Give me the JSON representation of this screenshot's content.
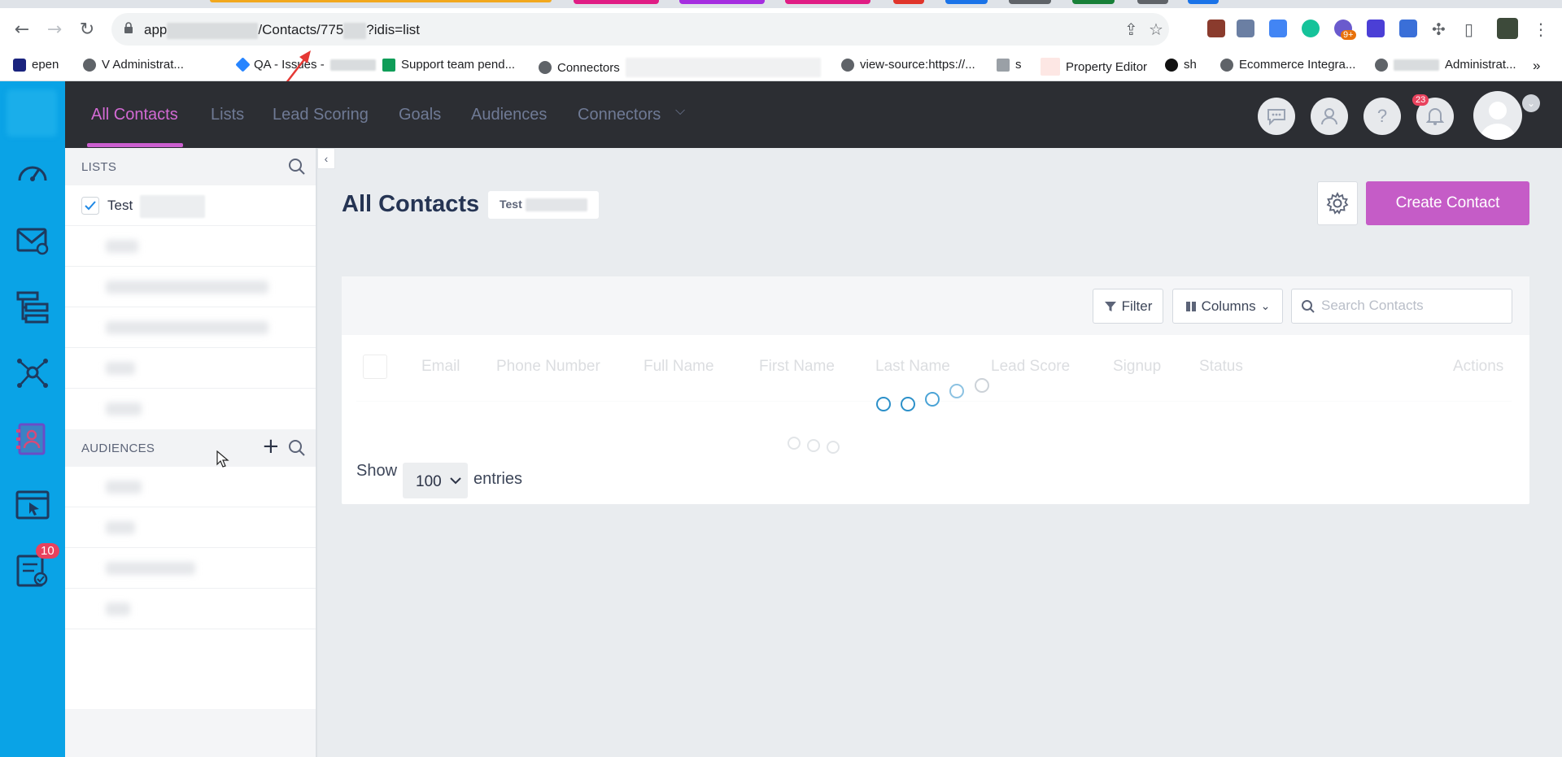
{
  "browser": {
    "url_prefix": "app",
    "url_middle": "/Contacts/775",
    "url_suffix": "?idis=list",
    "ext_badge": "9+"
  },
  "bookmarks": [
    {
      "label": "epen",
      "icon": "app-icon"
    },
    {
      "label": "V     Administrat...",
      "icon": "globe-icon"
    },
    {
      "label": "QA - Issues -",
      "icon": "jira-icon"
    },
    {
      "label": "Support team pend...",
      "icon": "sheets-icon"
    },
    {
      "label": "Connectors",
      "icon": "globe-icon"
    },
    {
      "label": "view-source:https://...",
      "icon": "globe-icon"
    },
    {
      "label": "s",
      "icon": "keyboard-icon"
    },
    {
      "label": "Property Editor",
      "icon": "page-icon"
    },
    {
      "label": "sh",
      "icon": "sns-icon"
    },
    {
      "label": "Ecommerce Integra...",
      "icon": "globe-icon"
    },
    {
      "label": "Administrat...",
      "icon": "globe-icon"
    }
  ],
  "rail": {
    "badge": "10"
  },
  "topnav": {
    "items": [
      "All Contacts",
      "Lists",
      "Lead Scoring",
      "Goals",
      "Audiences",
      "Connectors"
    ],
    "notification_badge": "23",
    "help": "?"
  },
  "sidebar": {
    "lists_title": "LISTS",
    "selected_list": "Test",
    "audiences_title": "AUDIENCES"
  },
  "main": {
    "title": "All Contacts",
    "tag": "Test",
    "create_button": "Create Contact",
    "filter_button": "Filter",
    "columns_button": "Columns",
    "search_placeholder": "Search Contacts",
    "columns": [
      "Email",
      "Phone Number",
      "Full Name",
      "First Name",
      "Last Name",
      "Lead Score",
      "Signup",
      "Status",
      "Actions"
    ],
    "show_label": "Show",
    "entries_value": "100",
    "entries_label": "entries"
  },
  "colors": {
    "rail": "#0aa3e6",
    "accent": "#c55cc7",
    "topbar": "#2c2e33"
  }
}
